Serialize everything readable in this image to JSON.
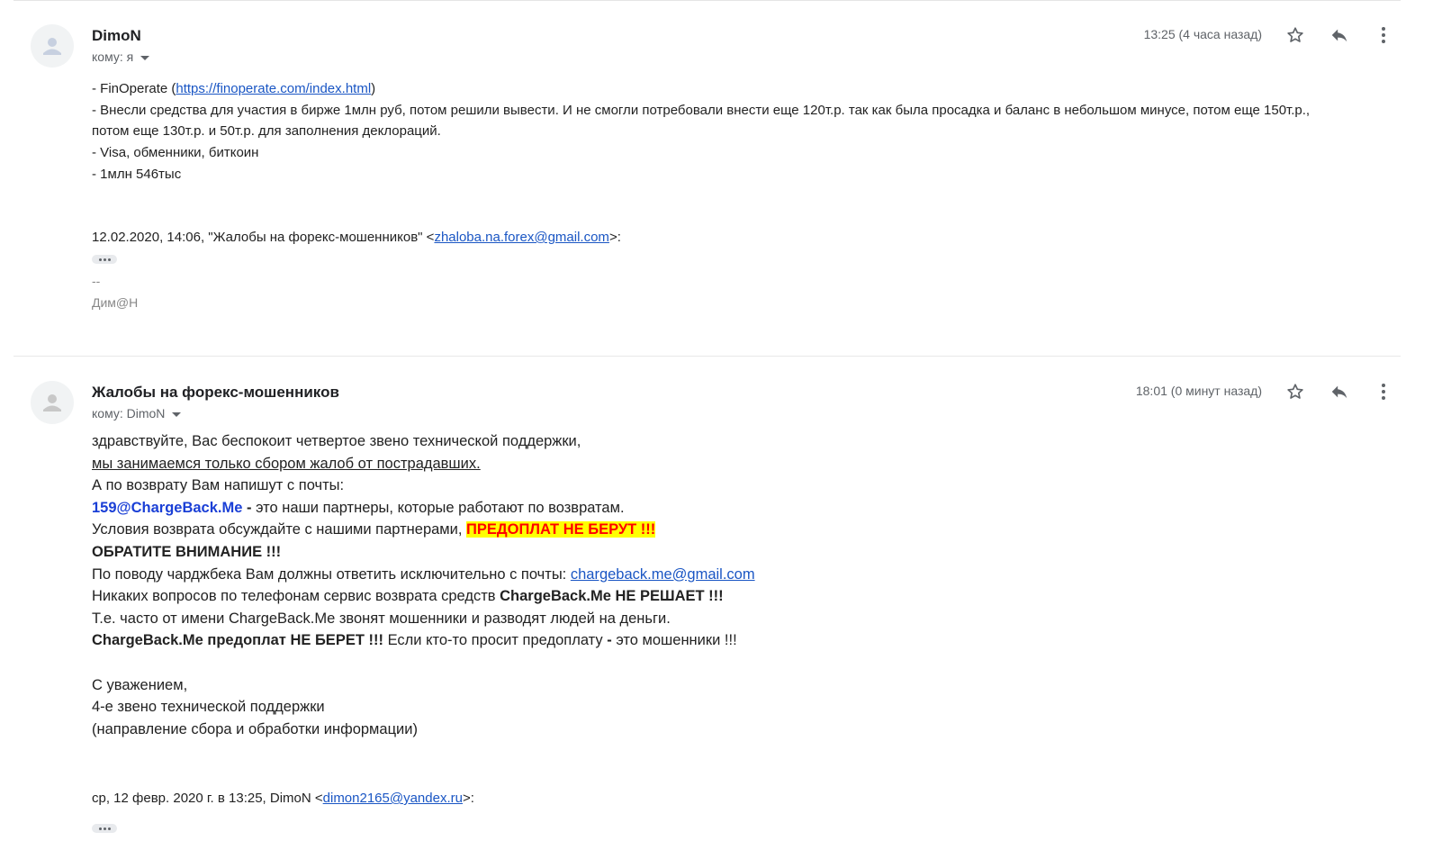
{
  "message1": {
    "sender": "DimoN",
    "to": "кому: я",
    "time": "13:25 (4 часа назад)",
    "body": {
      "line1_prefix": "- FinOperate (",
      "line1_link": "https://finoperate.com/index.html",
      "line1_suffix": ")",
      "line2": "- Внесли средства для участия в бирже 1млн руб, потом решили вывести. И не смогли потребовали внести еще 120т.р. так как была просадка и баланс в небольшом минусе, потом еще 150т.р.,",
      "line3": "потом еще 130т.р. и 50т.р. для заполнения деклораций.",
      "line4": "- Visa, обменники, биткоин",
      "line5": "- 1млн 546тыс"
    },
    "quote_prefix": "12.02.2020, 14:06, \"Жалобы на форекс-мошенников\" <",
    "quote_email": "zhaloba.na.forex@gmail.com",
    "quote_suffix": ">:",
    "sig_dash": "--",
    "sig_name": "Дим@Н"
  },
  "message2": {
    "sender": "Жалобы на форекс-мошенников",
    "to": "кому: DimoN",
    "time": "18:01 (0 минут назад)",
    "body": {
      "l1": "здравствуйте, Вас беспокоит четвертое звено технической поддержки,",
      "l2": "мы занимаемся только сбором жалоб от пострадавших.",
      "l3": "А по возврату Вам напишут с почты:",
      "l4_email": "159@ChargeBack.Me",
      "l4_dash": " - ",
      "l4_rest": "это наши партнеры, которые работают по возвратам.",
      "l5_text": "Условия возврата обсуждайте с нашими партнерами, ",
      "l5_highlight": "ПРЕДОПЛАТ НЕ БЕРУТ !!!",
      "l6": "ОБРАТИТЕ ВНИМАНИЕ !!!",
      "l7_text": "По поводу чарджбека Вам должны ответить исключительно с почты: ",
      "l7_link": "chargeback.me@gmail.com",
      "l8_text": "Никаких вопросов по телефонам сервис возврата средств ",
      "l8_bold": "ChargeBack.Me НЕ РЕШАЕТ !!!",
      "l9": "Т.е. часто от имени ChargeBack.Me звонят мошенники и разводят людей на деньги.",
      "l10_bold": "ChargeBack.Me предоплат НЕ БЕРЕТ !!!",
      "l10_text": " Если кто-то просит предоплату ",
      "l10_dash": "-",
      "l10_end": " это мошенники !!!",
      "l11": "С уважением,",
      "l12": "4-е звено технической поддержки",
      "l13": "(направление сбора и обработки информации)"
    },
    "quote_prefix": "ср, 12 февр. 2020 г. в 13:25, DimoN <",
    "quote_email": "dimon2165@yandex.ru",
    "quote_suffix": ">:"
  },
  "icons": {
    "avatar": "person-avatar-icon",
    "star": "star-icon",
    "reply": "reply-icon",
    "more": "more-vert-icon",
    "ellipsis": "show-trimmed-content-icon"
  },
  "colors": {
    "link": "#1a56c4",
    "highlight_bg": "#ffff00",
    "highlight_text": "#ff0000",
    "partner_email": "#1a3fd6"
  }
}
